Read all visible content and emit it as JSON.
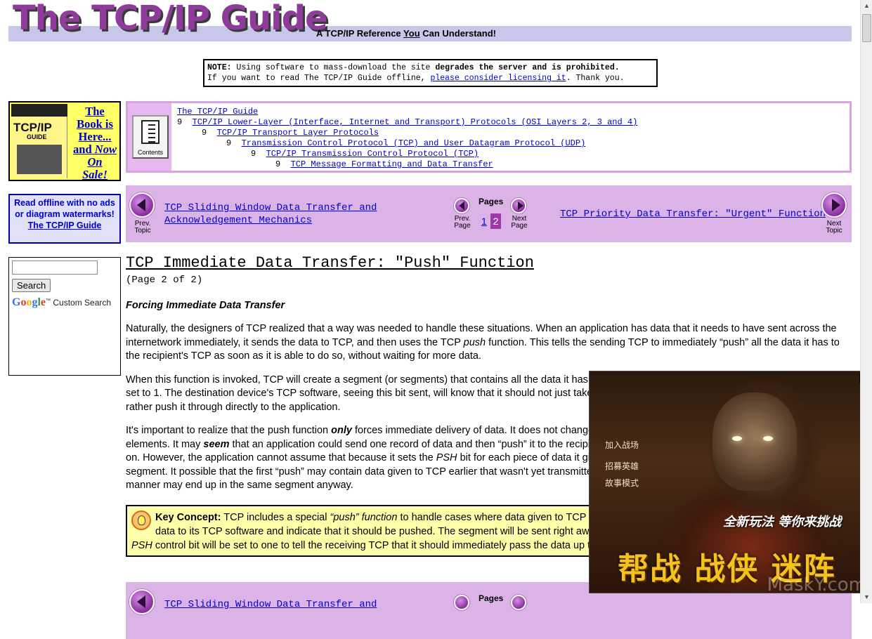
{
  "header": {
    "logo_text": "The TCP/IP Guide",
    "tagline_pre": "A TCP/IP Reference ",
    "tagline_you": "You",
    "tagline_post": " Can Understand!"
  },
  "note": {
    "label": "NOTE:",
    "text1": " Using software to mass-download the site ",
    "bold": "degrades the server and is prohibited.",
    "text2": "If you want to read The TCP/IP Guide offline, ",
    "link": "please consider licensing it",
    "text3": ". Thank you."
  },
  "book_ad": {
    "cover_title": "TCP/IP",
    "cover_guide": "GUIDE",
    "line1": "The",
    "line2": "Book is",
    "line3": "Here...",
    "line4a": "and",
    "line4b": "Now",
    "line5": "On",
    "line6": "Sale!"
  },
  "offline_box": {
    "text": "Read offline with no ads or diagram watermarks!",
    "link": "The TCP/IP Guide"
  },
  "search": {
    "button": "Search",
    "google": "Google",
    "custom": "Custom Search"
  },
  "breadcrumb": {
    "contents_label": "Contents",
    "bullet": "9",
    "items": [
      "The TCP/IP Guide",
      "TCP/IP Lower-Layer (Interface, Internet and Transport) Protocols (OSI Layers 2, 3 and 4)",
      "TCP/IP Transport Layer Protocols",
      "Transmission Control Protocol (TCP) and User Datagram Protocol (UDP)",
      "TCP/IP Transmission Control Protocol (TCP)",
      "TCP Message Formatting and Data Transfer"
    ]
  },
  "nav": {
    "prev_topic_label_1": "Prev.",
    "prev_topic_label_2": "Topic",
    "prev_link_1": "TCP Sliding Window Data Transfer and",
    "prev_link_2": "Acknowledgement Mechanics",
    "prev_page_1": "Prev.",
    "prev_page_2": "Page",
    "pages_label": "Pages",
    "page1": "1",
    "page2": "2",
    "next_page_1": "Next",
    "next_page_2": "Page",
    "next_link": "TCP Priority Data Transfer: \"Urgent\" Function",
    "next_topic_label_1": "Next",
    "next_topic_label_2": "Topic"
  },
  "article": {
    "title": "TCP Immediate Data Transfer: \"Push\" Function",
    "page_info": "(Page 2 of 2)",
    "section_heading": "Forcing Immediate Data Transfer",
    "p1_a": "Naturally, the designers of TCP realized that a way was needed to handle these situations. When an application has data that it needs to have sent across the internetwork immediately, it sends the data to TCP, and then uses the TCP ",
    "p1_em": "push",
    "p1_b": " function. This tells the sending TCP to immediately “push” all the data it has to the recipient's TCP as soon as it is able to do so, without waiting for more data.",
    "p2": "When this function is invoked, TCP will create a segment (or segments) that contains all the data it has outstanding, and will transmit it with the PSH control bit set to 1. The destination device's TCP software, seeing this bit sent, will know that it should not just take the data in the segment it received and buffer it, but rather push it through directly to the application.",
    "p3_a": "It's important to realize that the push function ",
    "p3_only": "only",
    "p3_b": " forces immediate delivery of data. It does not change the fact that TCP provides no boundaries between data elements. It may ",
    "p3_seem": "seem",
    "p3_c": " that an application could send one record of data and then “push” it to the recipient; then send the second record and “push” that, and so on. However, the application cannot assume that because it sets the ",
    "p3_psh": "PSH",
    "p3_d": " bit for each piece of data it gives to TCP, that each piece of data will be in a single segment. It possible that the first “push” may contain data given to TCP earlier that wasn't yet transmitted, and it's also possible that two records “pushed” in this manner may end up in the same segment anyway."
  },
  "key_concept": {
    "label": "Key Concept:",
    "text_a": " TCP includes a special ",
    "em": "“push” function",
    "text_b": " to handle cases where data given to TCP needs to be sent immediately. An application can send data to its TCP software and indicate that it should be pushed. The segment will be sent right away rather than being buffered. The pushed segment’s ",
    "psh": "PSH",
    "text_c": " control bit will be set to one to tell the receiving TCP that it should immediately pass the data up to the receiving application."
  },
  "popup_ad": {
    "close": "×",
    "menu": [
      "加入战场",
      "招募英雄",
      "故事模式"
    ],
    "slogan": "全新玩法 等你来挑战",
    "big": "帮战 战侠 迷阵",
    "watermark": "MaskY.com"
  }
}
